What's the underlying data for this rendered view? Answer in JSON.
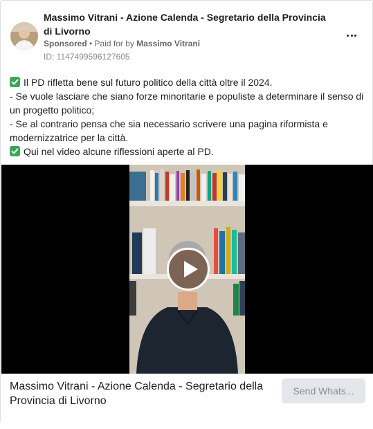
{
  "ad": {
    "advertiser": "Massimo Vitrani - Azione Calenda - Segretario della Provincia di Livorno",
    "sponsored_label": "Sponsored",
    "paid_for_prefix": " • Paid for by ",
    "payer": "Massimo Vitrani",
    "ad_id": "ID: 1147499596127605"
  },
  "body": {
    "line1": "Il PD rifletta bene sul futuro politico della città oltre il 2024.",
    "line2": "- Se vuole lasciare che siano forze minoritarie e populiste a determinare il senso di un progetto politico;",
    "line3": "- Se al contrario pensa che sia necessario scrivere una pagina riformista e modernizzatrice per la città.",
    "line4": "Qui nel video alcune riflessioni aperte al PD."
  },
  "footer": {
    "title": "Massimo Vitrani - Azione Calenda - Segretario della Provincia di Livorno",
    "cta_label": "Send Whats..."
  },
  "colors": {
    "check_green": "#3aa757",
    "cta_bg": "#e4e6eb",
    "video_bg": "#000000"
  },
  "icons": {
    "menu": "more-horizontal-icon",
    "check": "check-mark-icon",
    "play": "play-icon"
  }
}
